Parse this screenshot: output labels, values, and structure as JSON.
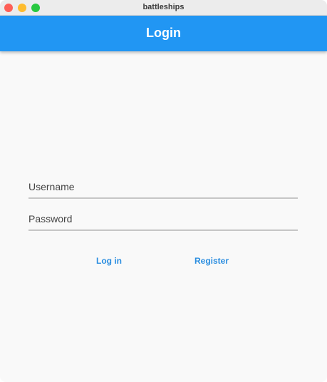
{
  "window": {
    "title": "battleships"
  },
  "appbar": {
    "title": "Login",
    "color": "#2196f3"
  },
  "form": {
    "username_placeholder": "Username",
    "username_value": "",
    "password_placeholder": "Password",
    "password_value": ""
  },
  "actions": {
    "login_label": "Log in",
    "register_label": "Register",
    "link_color": "#2b8ee0"
  }
}
